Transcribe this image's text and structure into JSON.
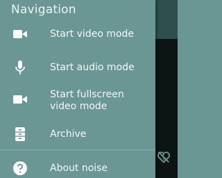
{
  "drawer": {
    "title": "Navigation",
    "items": [
      {
        "label": "Start video mode",
        "icon": "videocam-icon"
      },
      {
        "label": "Start audio mode",
        "icon": "microphone-icon"
      },
      {
        "label": "Start fullscreen video mode",
        "icon": "videocam-icon"
      },
      {
        "label": "Archive",
        "icon": "archive-icon"
      }
    ],
    "footer_items": [
      {
        "label": "About noise",
        "icon": "help-icon"
      }
    ]
  },
  "colors": {
    "drawer_bg": "#6a9794",
    "text": "#f4f9f8",
    "icon": "#ffffff",
    "background_dark": "#0c1414",
    "topbar": "#2f4f4c"
  }
}
